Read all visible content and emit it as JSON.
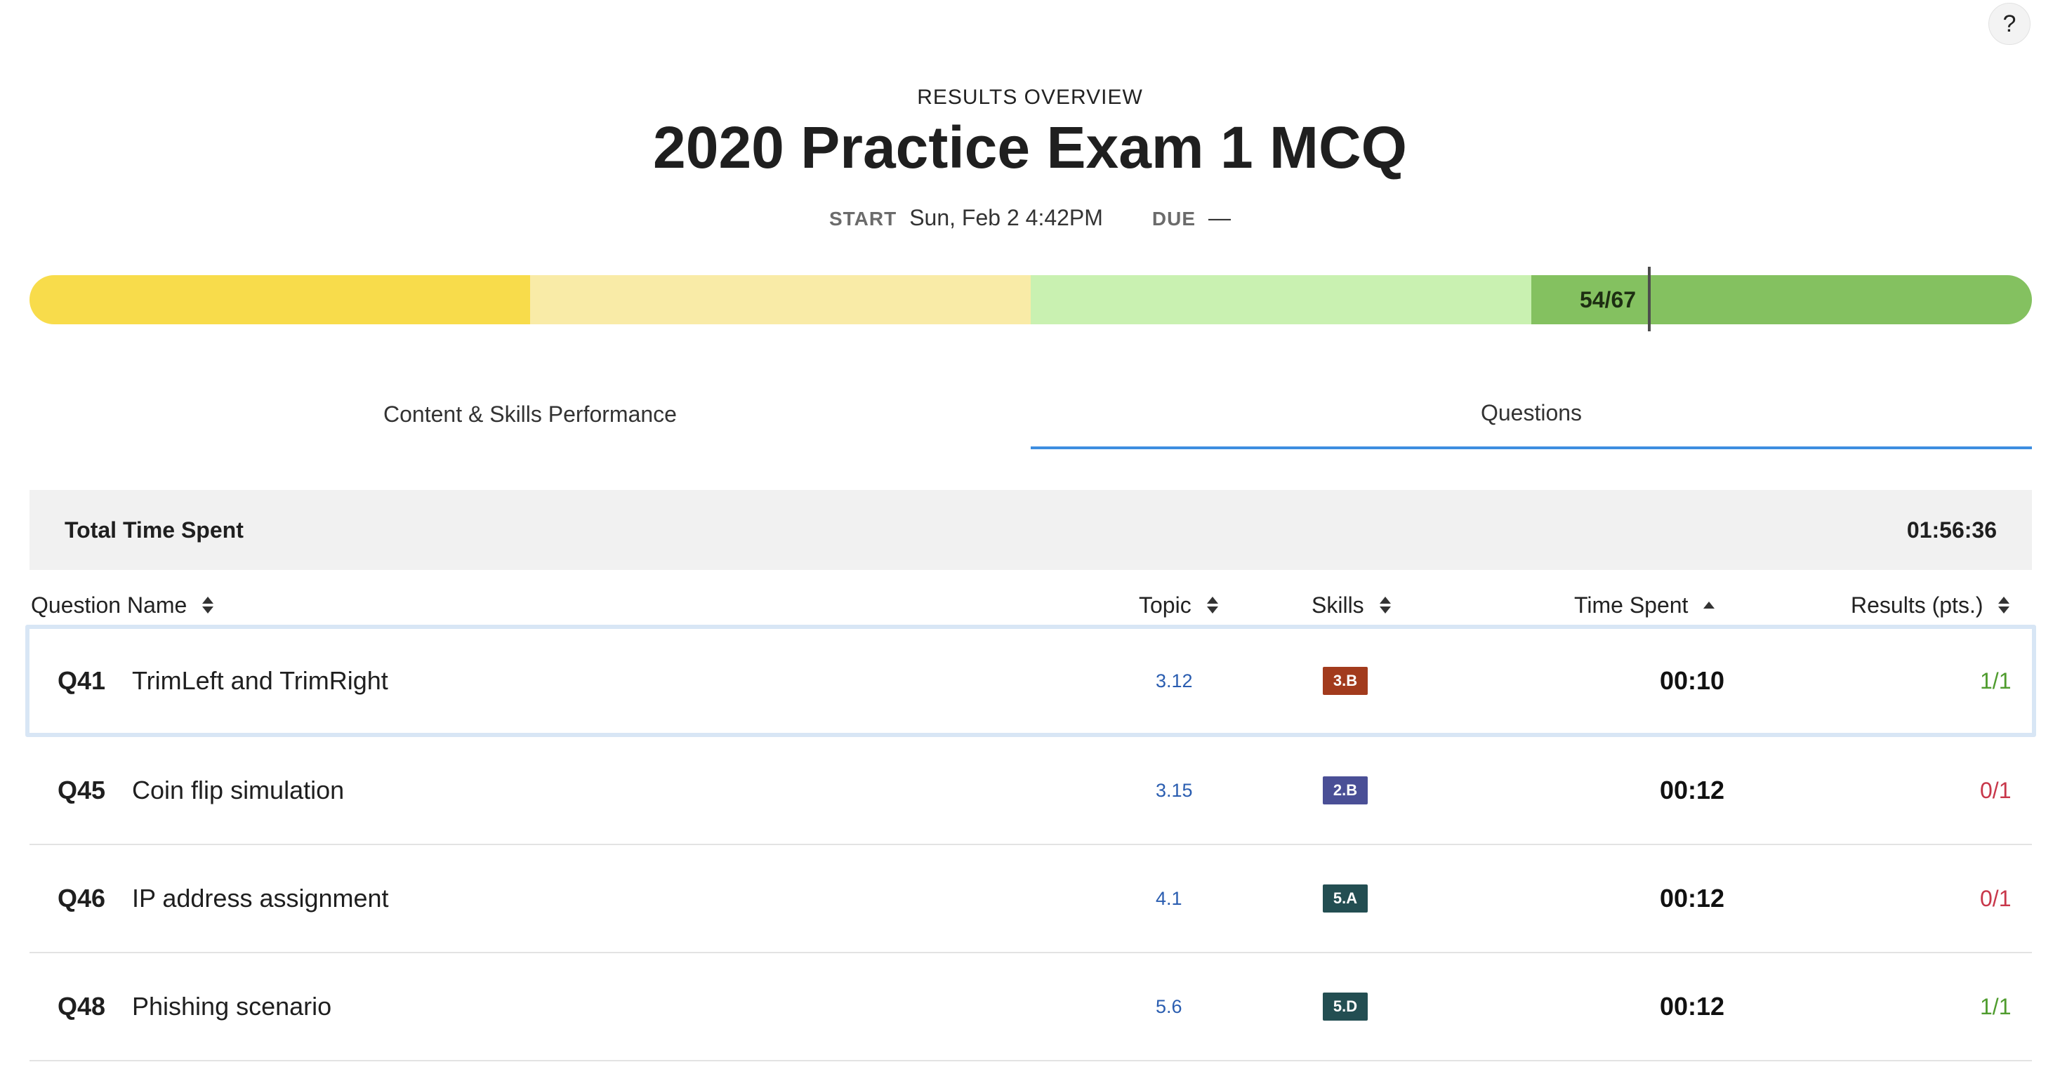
{
  "help": {
    "label": "?"
  },
  "header": {
    "overline": "RESULTS OVERVIEW",
    "title": "2020 Practice Exam 1 MCQ",
    "start_label": "START",
    "start_value": "Sun, Feb 2 4:42PM",
    "due_label": "DUE",
    "due_value": "—"
  },
  "progress": {
    "score_label": "54/67",
    "score": 54,
    "max": 67,
    "colors": [
      "#f8dc4b",
      "#f9eba7",
      "#c9f1b1",
      "#84c160"
    ]
  },
  "tabs": [
    {
      "label": "Content & Skills Performance",
      "active": false
    },
    {
      "label": "Questions",
      "active": true
    }
  ],
  "total": {
    "label": "Total Time Spent",
    "value": "01:56:36"
  },
  "table": {
    "columns": {
      "question_name": "Question Name",
      "topic": "Topic",
      "skills": "Skills",
      "time_spent": "Time Spent",
      "results": "Results (pts.)"
    },
    "rows": [
      {
        "num": "Q41",
        "name": "TrimLeft and TrimRight",
        "topic": "3.12",
        "skill": "3.B",
        "skill_color": "#a23b1d",
        "time": "00:10",
        "result": "1/1",
        "result_color": "#4f9c2e"
      },
      {
        "num": "Q45",
        "name": "Coin flip simulation",
        "topic": "3.15",
        "skill": "2.B",
        "skill_color": "#4a4f96",
        "time": "00:12",
        "result": "0/1",
        "result_color": "#c8374a"
      },
      {
        "num": "Q46",
        "name": "IP address assignment",
        "topic": "4.1",
        "skill": "5.A",
        "skill_color": "#234e52",
        "time": "00:12",
        "result": "0/1",
        "result_color": "#c8374a"
      },
      {
        "num": "Q48",
        "name": "Phishing scenario",
        "topic": "5.6",
        "skill": "5.D",
        "skill_color": "#234e52",
        "time": "00:12",
        "result": "1/1",
        "result_color": "#4f9c2e"
      }
    ]
  }
}
